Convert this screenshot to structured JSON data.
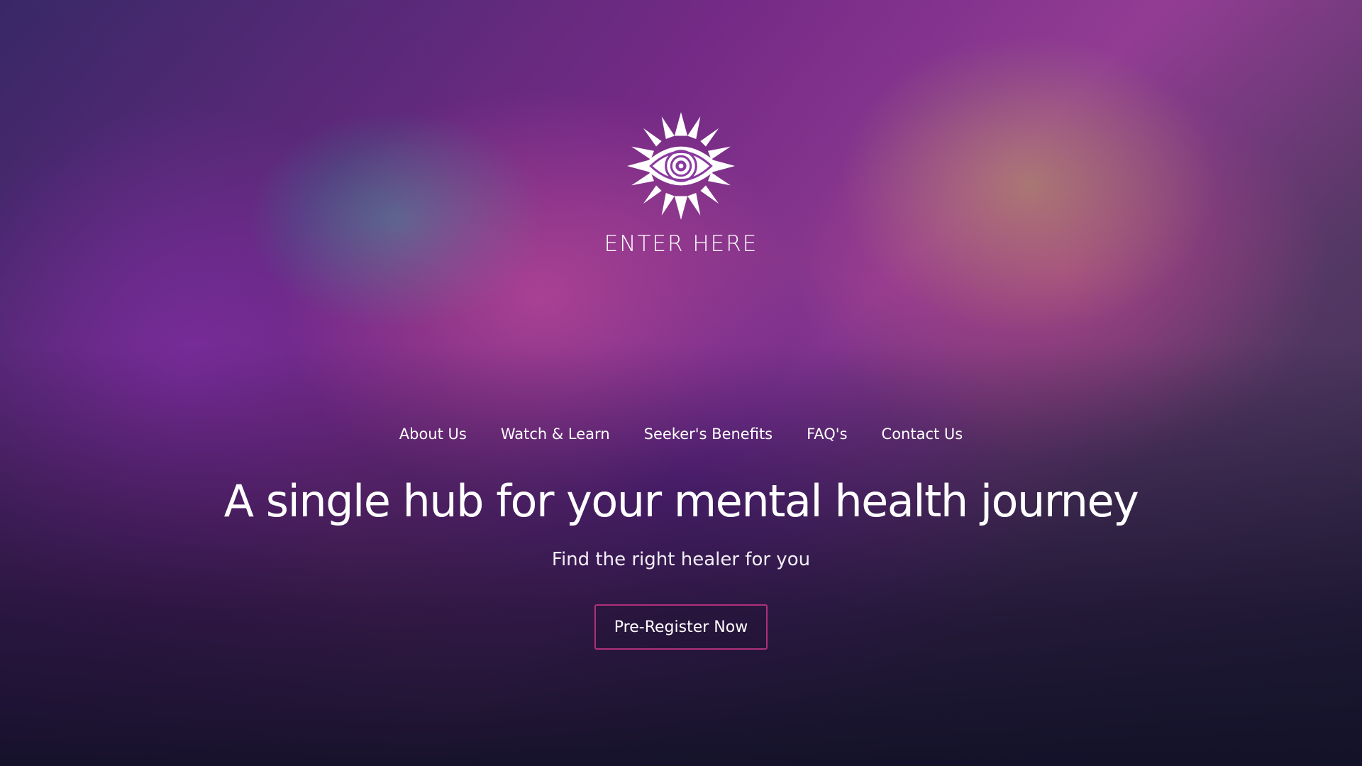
{
  "brand": {
    "logo_icon": "sun-eye-emblem",
    "logo_text": "ENTER HERE"
  },
  "nav": {
    "items": [
      {
        "label": "About Us"
      },
      {
        "label": "Watch & Learn"
      },
      {
        "label": "Seeker's Benefits"
      },
      {
        "label": "FAQ's"
      },
      {
        "label": "Contact Us"
      }
    ]
  },
  "hero": {
    "headline": "A single hub for your mental health journey",
    "subheadline": "Find the right healer for you",
    "cta_label": "Pre-Register Now"
  },
  "colors": {
    "accent_border": "#b0307a",
    "text": "#ffffff",
    "bottom_fade": "#10102a"
  }
}
